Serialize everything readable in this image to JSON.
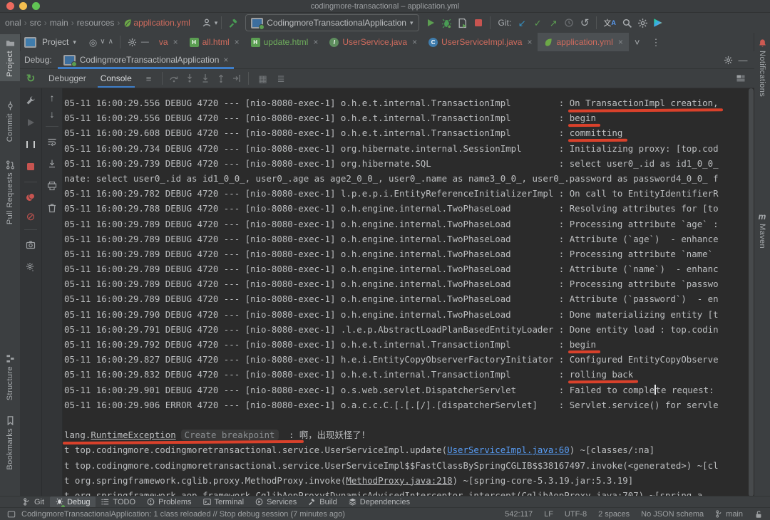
{
  "window": {
    "title": "codingmore-transactional – application.yml"
  },
  "icons": {
    "chevron_down": "▾",
    "chevron_down_big": "˅",
    "close": "×",
    "kebab": "⋮",
    "minimize": "—",
    "hamburger": "≡",
    "arrow_up": "↑",
    "arrow_down": "↓",
    "arrow_ne": "↗",
    "arrow_sw": "↙",
    "check": "✓",
    "undo": "↺",
    "rerun": "↻",
    "mute": "⊘",
    "locate": "◎",
    "expand": "∨",
    "collapse": "∧",
    "calculator": "▦",
    "settings_lines": "≣",
    "translate_cn": "文",
    "translate_a": "A",
    "maven_m": "m"
  },
  "breadcrumb": {
    "items": [
      "onal",
      "src",
      "main",
      "resources"
    ],
    "file": "application.yml"
  },
  "toolbar": {
    "run_config": "CodingmoreTransactionalApplication",
    "git_label": "Git:"
  },
  "project_panel": {
    "title": "Project"
  },
  "editor_tabs": [
    {
      "label": "va",
      "color": "red"
    },
    {
      "label": "all.html",
      "color": "red",
      "icon": "html"
    },
    {
      "label": "update.html",
      "color": "green",
      "icon": "html"
    },
    {
      "label": "UserService.java",
      "color": "red",
      "icon": "interface",
      "badge": "I"
    },
    {
      "label": "UserServiceImpl.java",
      "color": "red",
      "icon": "class",
      "badge": "C"
    },
    {
      "label": "application.yml",
      "color": "red",
      "icon": "leaf",
      "selected": true
    }
  ],
  "left_stripe": {
    "project": "Project",
    "commit": "Commit",
    "pull_requests": "Pull Requests",
    "structure": "Structure",
    "bookmarks": "Bookmarks"
  },
  "right_stripe": {
    "notifications": "Notifications",
    "maven": "Maven"
  },
  "debug_panel": {
    "label": "Debug:",
    "session": "CodingmoreTransactionalApplication",
    "tabs": [
      "Debugger",
      "Console"
    ]
  },
  "console": {
    "lines": [
      {
        "kind": "log",
        "time": "05-11 16:00:29.556",
        "level": "DEBUG",
        "pid": "4720",
        "thread": "nio-8080-exec-1",
        "logger": "o.h.e.t.internal.TransactionImpl",
        "message": "On TransactionImpl creation,",
        "marked": true
      },
      {
        "kind": "log",
        "time": "05-11 16:00:29.556",
        "level": "DEBUG",
        "pid": "4720",
        "thread": "nio-8080-exec-1",
        "logger": "o.h.e.t.internal.TransactionImpl",
        "message": "begin",
        "marked": true
      },
      {
        "kind": "log",
        "time": "05-11 16:00:29.608",
        "level": "DEBUG",
        "pid": "4720",
        "thread": "nio-8080-exec-1",
        "logger": "o.h.e.t.internal.TransactionImpl",
        "message": "committing",
        "marked": true
      },
      {
        "kind": "log",
        "time": "05-11 16:00:29.734",
        "level": "DEBUG",
        "pid": "4720",
        "thread": "nio-8080-exec-1",
        "logger": "org.hibernate.internal.SessionImpl",
        "message": "Initializing proxy: [top.cod"
      },
      {
        "kind": "log",
        "time": "05-11 16:00:29.739",
        "level": "DEBUG",
        "pid": "4720",
        "thread": "nio-8080-exec-1",
        "logger": "org.hibernate.SQL",
        "message": "select user0_.id as id1_0_0_"
      },
      {
        "kind": "raw",
        "text": "nate: select user0_.id as id1_0_0_, user0_.age as age2_0_0_, user0_.name as name3_0_0_, user0_.password as password4_0_0_ f"
      },
      {
        "kind": "log",
        "time": "05-11 16:00:29.782",
        "level": "DEBUG",
        "pid": "4720",
        "thread": "nio-8080-exec-1",
        "logger": "l.p.e.p.i.EntityReferenceInitializerImpl",
        "message": "On call to EntityIdentifierR"
      },
      {
        "kind": "log",
        "time": "05-11 16:00:29.788",
        "level": "DEBUG",
        "pid": "4720",
        "thread": "nio-8080-exec-1",
        "logger": "o.h.engine.internal.TwoPhaseLoad",
        "message": "Resolving attributes for [to"
      },
      {
        "kind": "log",
        "time": "05-11 16:00:29.789",
        "level": "DEBUG",
        "pid": "4720",
        "thread": "nio-8080-exec-1",
        "logger": "o.h.engine.internal.TwoPhaseLoad",
        "message": "Processing attribute `age` :"
      },
      {
        "kind": "log",
        "time": "05-11 16:00:29.789",
        "level": "DEBUG",
        "pid": "4720",
        "thread": "nio-8080-exec-1",
        "logger": "o.h.engine.internal.TwoPhaseLoad",
        "message": "Attribute (`age`)  - enhance"
      },
      {
        "kind": "log",
        "time": "05-11 16:00:29.789",
        "level": "DEBUG",
        "pid": "4720",
        "thread": "nio-8080-exec-1",
        "logger": "o.h.engine.internal.TwoPhaseLoad",
        "message": "Processing attribute `name`"
      },
      {
        "kind": "log",
        "time": "05-11 16:00:29.789",
        "level": "DEBUG",
        "pid": "4720",
        "thread": "nio-8080-exec-1",
        "logger": "o.h.engine.internal.TwoPhaseLoad",
        "message": "Attribute (`name`)  - enhanc"
      },
      {
        "kind": "log",
        "time": "05-11 16:00:29.789",
        "level": "DEBUG",
        "pid": "4720",
        "thread": "nio-8080-exec-1",
        "logger": "o.h.engine.internal.TwoPhaseLoad",
        "message": "Processing attribute `passwo"
      },
      {
        "kind": "log",
        "time": "05-11 16:00:29.789",
        "level": "DEBUG",
        "pid": "4720",
        "thread": "nio-8080-exec-1",
        "logger": "o.h.engine.internal.TwoPhaseLoad",
        "message": "Attribute (`password`)  - en"
      },
      {
        "kind": "log",
        "time": "05-11 16:00:29.790",
        "level": "DEBUG",
        "pid": "4720",
        "thread": "nio-8080-exec-1",
        "logger": "o.h.engine.internal.TwoPhaseLoad",
        "message": "Done materializing entity [t"
      },
      {
        "kind": "log",
        "time": "05-11 16:00:29.791",
        "level": "DEBUG",
        "pid": "4720",
        "thread": "nio-8080-exec-1",
        "logger": ".l.e.p.AbstractLoadPlanBasedEntityLoader",
        "message": "Done entity load : top.codin"
      },
      {
        "kind": "log",
        "time": "05-11 16:00:29.792",
        "level": "DEBUG",
        "pid": "4720",
        "thread": "nio-8080-exec-1",
        "logger": "o.h.e.t.internal.TransactionImpl",
        "message": "begin",
        "marked": true
      },
      {
        "kind": "log",
        "time": "05-11 16:00:29.827",
        "level": "DEBUG",
        "pid": "4720",
        "thread": "nio-8080-exec-1",
        "logger": "h.e.i.EntityCopyObserverFactoryInitiator",
        "message": "Configured EntityCopyObserve"
      },
      {
        "kind": "log",
        "time": "05-11 16:00:29.832",
        "level": "DEBUG",
        "pid": "4720",
        "thread": "nio-8080-exec-1",
        "logger": "o.h.e.t.internal.TransactionImpl",
        "message": "rolling back",
        "marked": true
      },
      {
        "kind": "log",
        "time": "05-11 16:00:29.901",
        "level": "DEBUG",
        "pid": "4720",
        "thread": "nio-8080-exec-1",
        "logger": "o.s.web.servlet.DispatcherServlet",
        "message": "Failed to comple",
        "caret": true,
        "message2": "te request:"
      },
      {
        "kind": "log",
        "time": "05-11 16:00:29.906",
        "level": "ERROR",
        "pid": "4720",
        "thread": "nio-8080-exec-1",
        "logger": "o.a.c.c.C.[.[.[/].[dispatcherServlet]",
        "message": "Servlet.service() for servle"
      },
      {
        "kind": "blank"
      },
      {
        "kind": "exception",
        "prefix": "lang.",
        "link": "RuntimeException",
        "pill": "Create breakpoint",
        "colon": " : ",
        "message": "啊，出现妖怪了！"
      },
      {
        "kind": "stack",
        "pre": "t top.codingmore.codingmoretransactional.service.UserServiceImpl.update(",
        "link": "UserServiceImpl.java:60",
        "link_style": "blue",
        "post": ") ~[classes/:na]"
      },
      {
        "kind": "stack",
        "pre": "t top.codingmore.codingmoretransactional.service.UserServiceImpl$$FastClassBySpringCGLIB$$38167497.invoke(<generated>) ~[cl"
      },
      {
        "kind": "stack",
        "pre": "t org.springframework.cglib.proxy.MethodProxy.invoke(",
        "link": "MethodProxy.java:218",
        "link_style": "gray",
        "post": ") ~[spring-core-5.3.19.jar:5.3.19]"
      },
      {
        "kind": "stack",
        "partial": true,
        "pre": "t org.springframework.aop.framework.CglibAopProxy$DynamicAdvisedInterceptor.intercept(",
        "link": "CglibAopProxy.java:707",
        "link_style": "gray",
        "post": ") ~[spring-a"
      }
    ]
  },
  "bottom_bar": {
    "git": "Git",
    "debug": "Debug",
    "todo": "TODO",
    "problems": "Problems",
    "terminal": "Terminal",
    "services": "Services",
    "build": "Build",
    "dependencies": "Dependencies"
  },
  "status_bar": {
    "message": "CodingmoreTransactionalApplication: 1 class reloaded // Stop debug session (7 minutes ago)",
    "position": "542:117",
    "line_ending": "LF",
    "encoding": "UTF-8",
    "indent": "2 spaces",
    "schema": "No JSON schema",
    "branch": "main"
  }
}
